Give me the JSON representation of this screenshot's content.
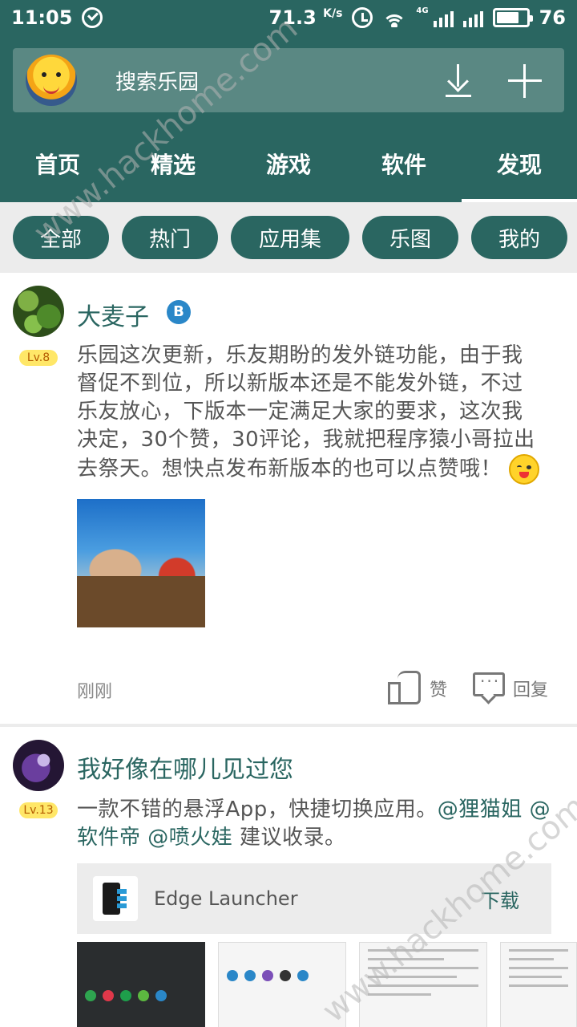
{
  "status_bar": {
    "time": "11:05",
    "speed": "71.3",
    "speed_unit": "K/s",
    "network_type": "4G",
    "battery": "76"
  },
  "header": {
    "search_placeholder": "搜索乐园",
    "tabs": [
      {
        "label": "首页",
        "active": false
      },
      {
        "label": "精选",
        "active": false
      },
      {
        "label": "游戏",
        "active": false
      },
      {
        "label": "软件",
        "active": false
      },
      {
        "label": "发现",
        "active": true
      }
    ]
  },
  "filters": [
    {
      "label": "全部"
    },
    {
      "label": "热门"
    },
    {
      "label": "应用集"
    },
    {
      "label": "乐图"
    },
    {
      "label": "我的"
    }
  ],
  "posts": [
    {
      "username": "大麦子",
      "verified_badge": "B",
      "level": "Lv.8",
      "lines": [
        "乐园这次更新，乐友期盼的发外链功能，由于我",
        "督促不到位，所以新版本还是不能发外链，不过",
        "乐友放心，下版本一定满足大家的要求，这次我",
        "决定，30个赞，30评论，我就把程序猿小哥拉出",
        "去祭天。想快点发布新版本的也可以点赞哦！"
      ],
      "time": "刚刚",
      "like_label": "赞",
      "reply_label": "回复"
    },
    {
      "username": "我好像在哪儿见过您",
      "level": "Lv.13",
      "text_prefix": "一款不错的悬浮App，快捷切换应用。",
      "mention1": "@狸猫姐",
      "mention2": "@软件帝",
      "mention3": "@喷火娃",
      "text_suffix": " 建议收录。",
      "app": {
        "name": "Edge Launcher",
        "download_label": "下载"
      }
    }
  ],
  "colors": {
    "primary": "#2a6661",
    "search_bg": "#5a8883",
    "chip_area_bg": "#ececec",
    "level_badge": "#ffe768"
  },
  "watermark": "www.hackhome.com"
}
